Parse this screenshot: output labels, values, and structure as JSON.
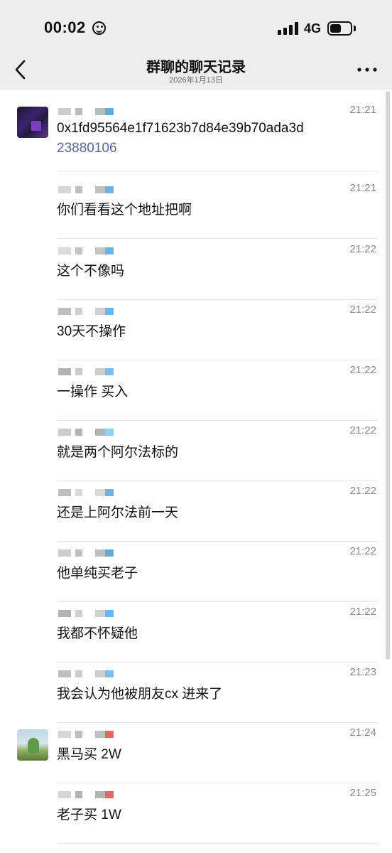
{
  "status_bar": {
    "time": "00:02",
    "network": "4G",
    "battery_level": 0.55,
    "icons": [
      "emoji-icon",
      "signal-icon",
      "battery-icon"
    ]
  },
  "header": {
    "title": "群聊的聊天记录",
    "date": "2026年1月13日",
    "back_icon": "chevron-left-icon",
    "more_icon": "more-dots-icon"
  },
  "messages": [
    {
      "time": "21:21",
      "text": "0x1fd95564e1f71623b7d84e39b70ada3d",
      "link": "23880106",
      "avatar": "purple-mosaic"
    },
    {
      "time": "21:21",
      "text": "你们看看这个地址把啊"
    },
    {
      "time": "21:22",
      "text": "这个不像吗"
    },
    {
      "time": "21:22",
      "text": "30天不操作"
    },
    {
      "time": "21:22",
      "text": "一操作 买入"
    },
    {
      "time": "21:22",
      "text": "就是两个阿尔法标的"
    },
    {
      "time": "21:22",
      "text": "还是上阿尔法前一天"
    },
    {
      "time": "21:22",
      "text": "他单纯买老子"
    },
    {
      "time": "21:22",
      "text": "我都不怀疑他"
    },
    {
      "time": "21:23",
      "text": "我会认为他被朋友cx 进来了"
    },
    {
      "time": "21:24",
      "text": "黑马买 2W",
      "avatar": "landscape"
    },
    {
      "time": "21:25",
      "text": "老子买 1W"
    }
  ],
  "colors": {
    "header_bg": "#ededed",
    "link": "#576b95",
    "time": "#888888"
  }
}
